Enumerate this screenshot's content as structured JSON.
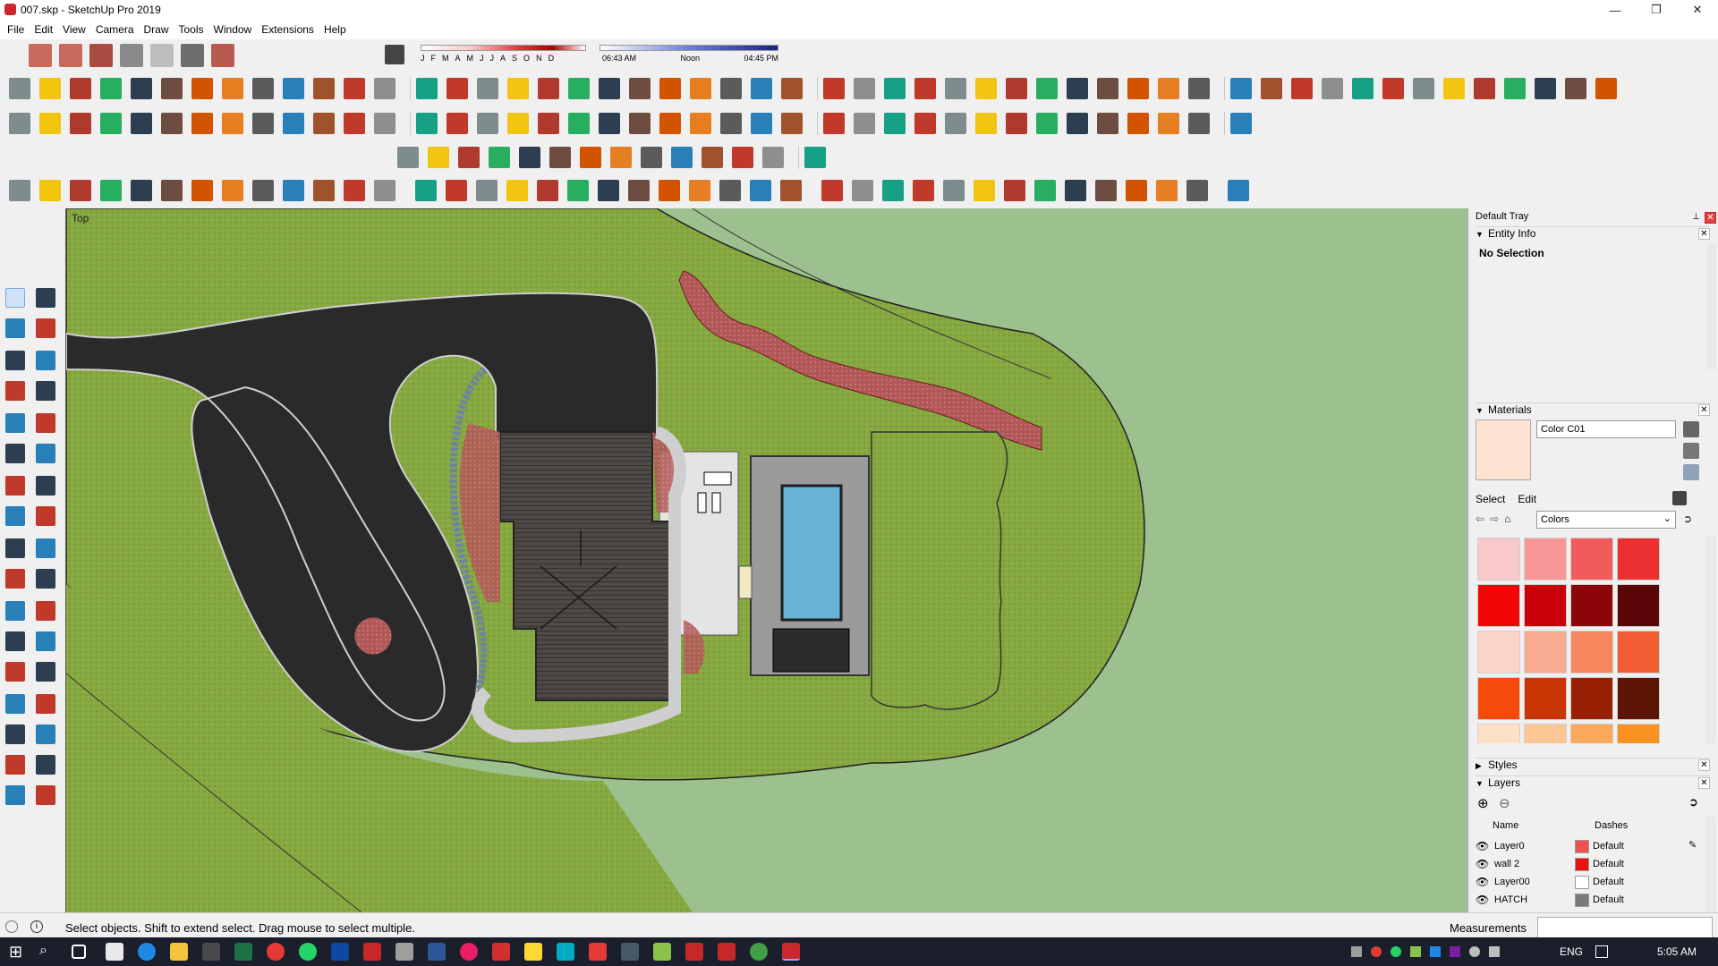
{
  "window": {
    "title": "007.skp - SketchUp Pro 2019",
    "minimize": "—",
    "maximize": "❐",
    "close": "✕"
  },
  "menu": [
    "File",
    "Edit",
    "View",
    "Camera",
    "Draw",
    "Tools",
    "Window",
    "Extensions",
    "Help"
  ],
  "shadows": {
    "months": [
      "J",
      "F",
      "M",
      "A",
      "M",
      "J",
      "J",
      "A",
      "S",
      "O",
      "N",
      "D"
    ],
    "time_start": "06:43 AM",
    "time_mid": "Noon",
    "time_end": "04:45 PM"
  },
  "viewport": {
    "view_name": "Top"
  },
  "tray": {
    "title": "Default Tray",
    "entity_info": {
      "header": "Entity Info",
      "selection": "No Selection"
    },
    "materials": {
      "header": "Materials",
      "current_name": "Color C01",
      "tabs": [
        "Select",
        "Edit"
      ],
      "library": "Colors",
      "swatches": [
        "#f9c8c8",
        "#f89797",
        "#f15b5b",
        "#ea3030",
        "#f20707",
        "#c90008",
        "#8c0509",
        "#5a0608",
        "#fbd4c8",
        "#f9ab92",
        "#f6875f",
        "#f25c33",
        "#f64b0a",
        "#c93505",
        "#972004",
        "#5d1606",
        "#fde1c6",
        "#fbc694",
        "#faa85a",
        "#f89120"
      ]
    },
    "styles": {
      "header": "Styles"
    },
    "layers": {
      "header": "Layers",
      "col_name": "Name",
      "col_dashes": "Dashes",
      "rows": [
        {
          "name": "Layer0",
          "color": "#f05151",
          "dashes": "Default"
        },
        {
          "name": "wall 2",
          "color": "#e81212",
          "dashes": "Default"
        },
        {
          "name": "Layer00",
          "color": "#ffffff",
          "dashes": "Default"
        },
        {
          "name": "HATCH",
          "color": "#7a7a7a",
          "dashes": "Default"
        }
      ]
    }
  },
  "status": {
    "hint": "Select objects. Shift to extend select. Drag mouse to select multiple.",
    "measurements_label": "Measurements"
  },
  "taskbar": {
    "language": "ENG",
    "time": "5:05 AM"
  },
  "colors": {
    "grass": "#86a840",
    "background_grass": "#9cc08e",
    "road": "#2a2a2a",
    "roof": "#4a4643",
    "pool_water": "#67b3d8",
    "flower_bed": "#b05757"
  }
}
